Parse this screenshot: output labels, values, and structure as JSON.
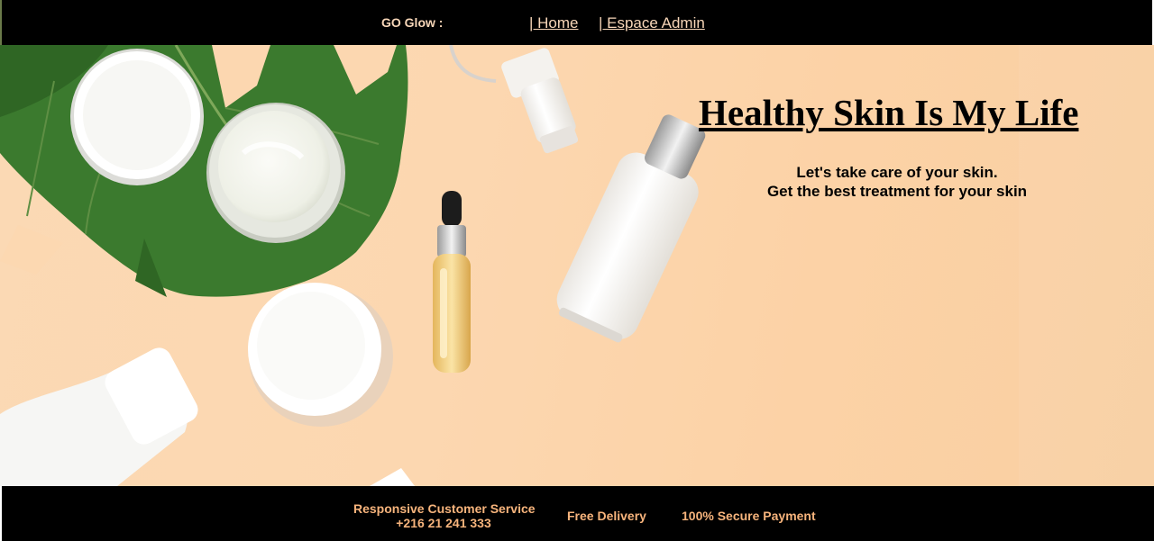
{
  "header": {
    "brand": "GO Glow :",
    "nav": {
      "home": "| Home",
      "admin": "| Espace Admin"
    }
  },
  "hero": {
    "title": "Healthy Skin Is My Life",
    "subtitle_line1": "Let's take care of your skin.",
    "subtitle_line2": "Get the best treatment for your skin",
    "image_subject": "skincare products with monstera leaf on peach background"
  },
  "footer": {
    "service_title": "Responsive Customer Service",
    "service_phone": "+216 21 241 333",
    "delivery": "Free Delivery",
    "payment": "100% Secure Payment"
  },
  "colors": {
    "bar_background": "#000000",
    "nav_text": "#f7d6b8",
    "footer_text": "#f7b47c",
    "hero_background": "#fcd7b0",
    "leaf": "#3f7a30",
    "title_text": "#000000"
  }
}
